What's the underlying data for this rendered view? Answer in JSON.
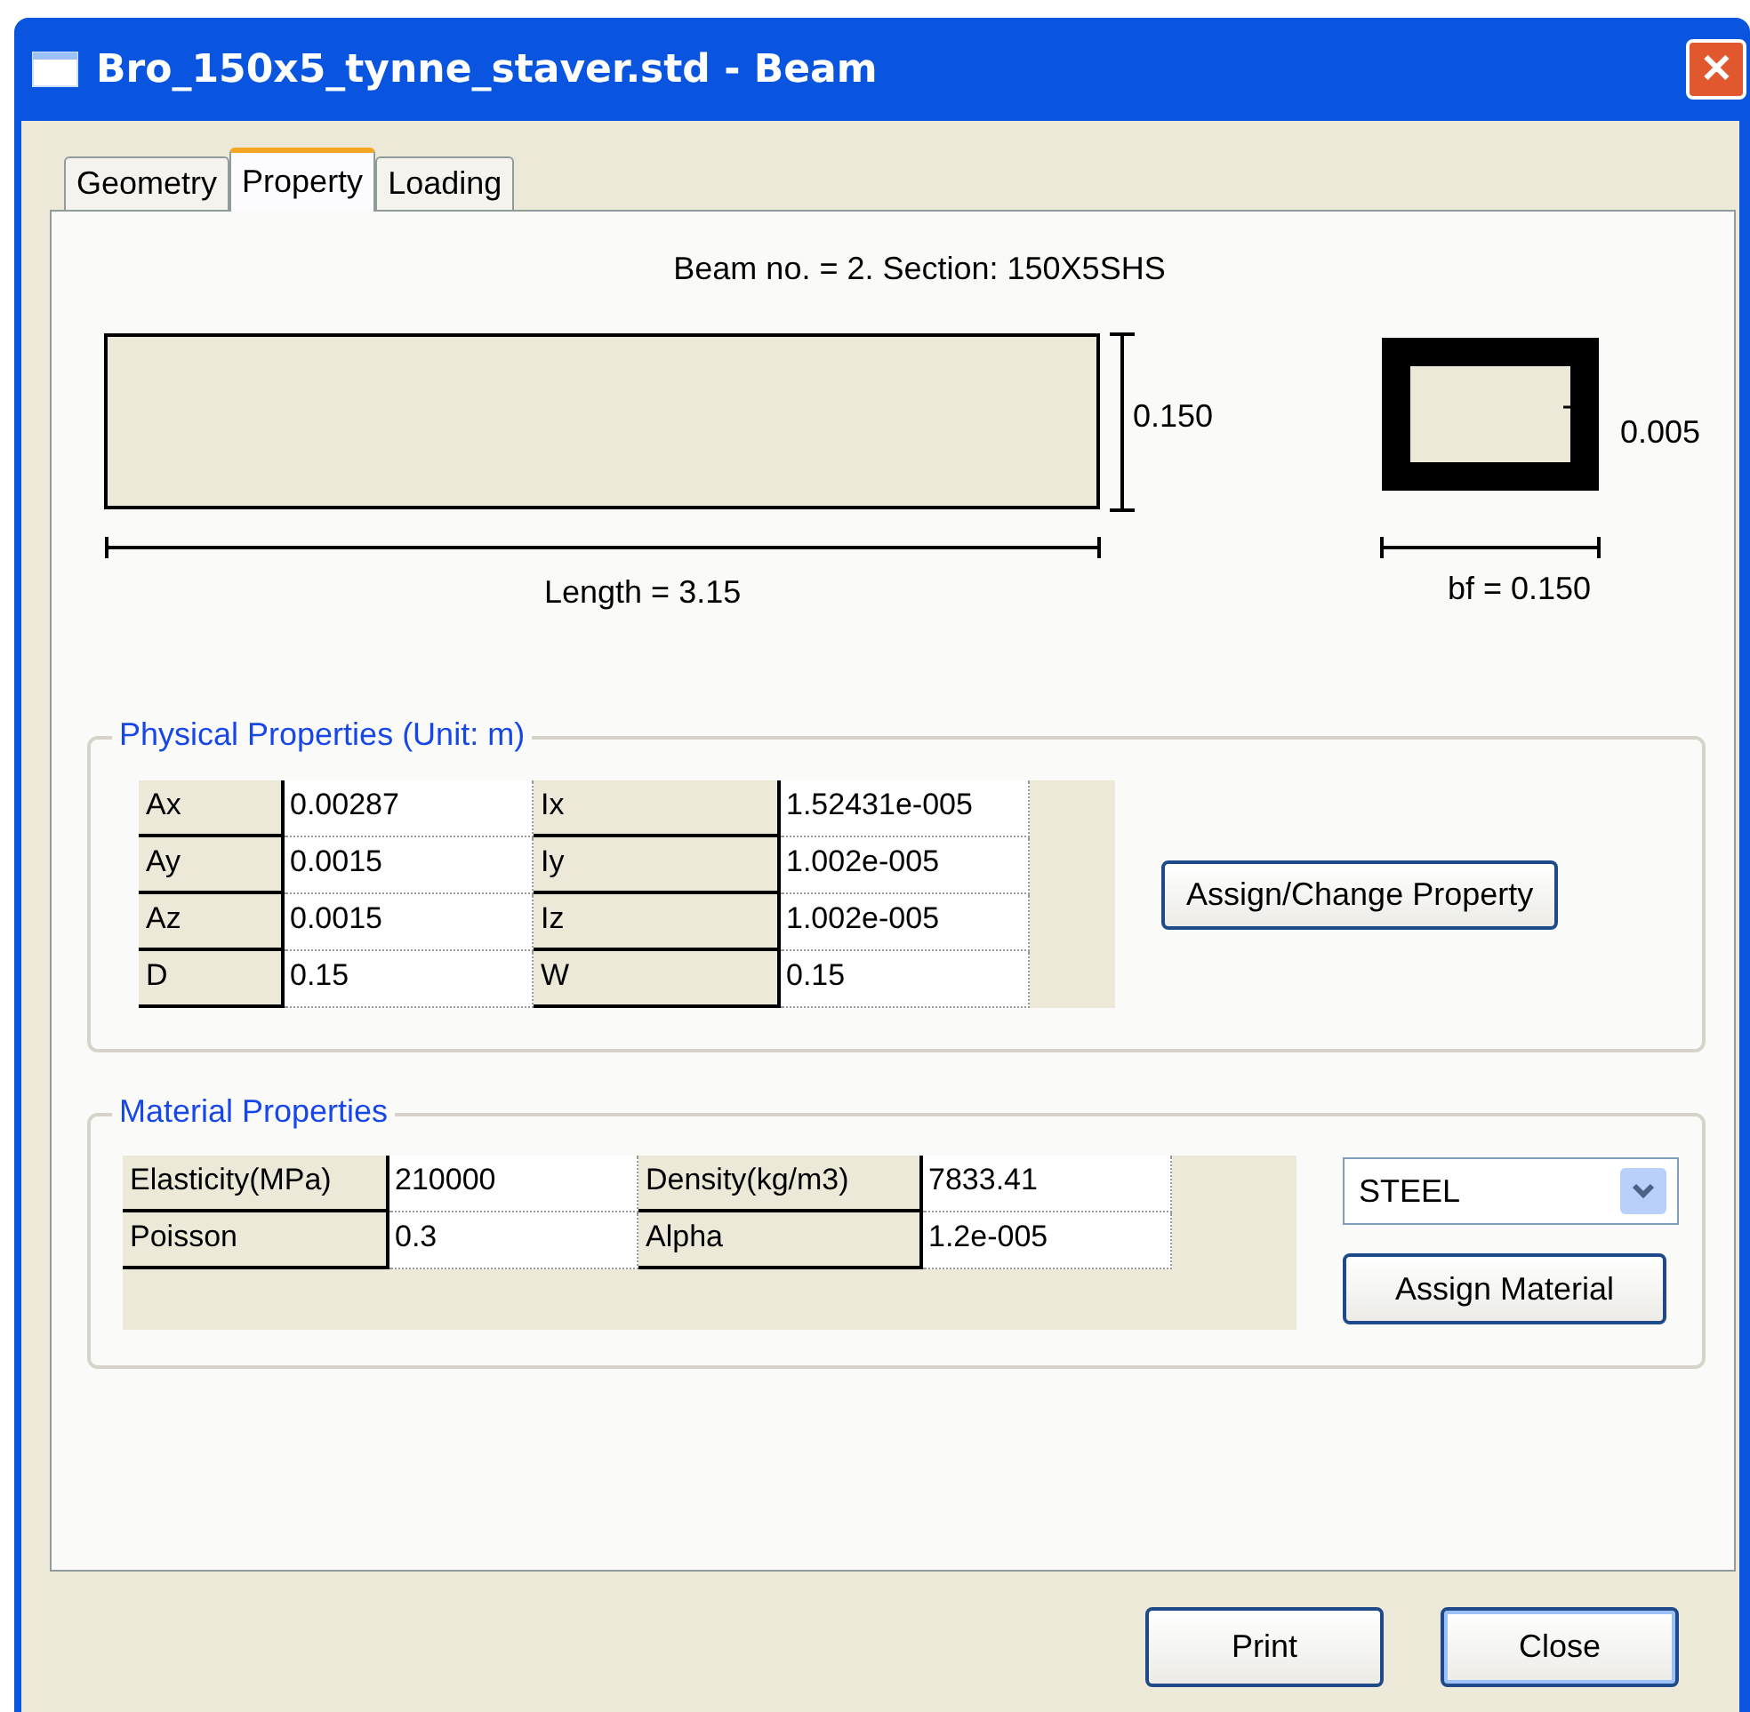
{
  "window": {
    "title": "Bro_150x5_tynne_staver.std - Beam",
    "close": "✕"
  },
  "tabs": [
    {
      "label": "Geometry",
      "selected": false
    },
    {
      "label": "Property",
      "selected": true
    },
    {
      "label": "Loading",
      "selected": false
    }
  ],
  "heading": "Beam no. = 2. Section: 150X5SHS",
  "drawing": {
    "depth_label": "0.150",
    "length_label": "Length = 3.15",
    "thickness_label": "0.005",
    "width_label": "bf = 0.150"
  },
  "physical": {
    "legend": "Physical Properties (Unit: m)",
    "rows": [
      [
        {
          "label": "Ax",
          "value": "0.00287"
        },
        {
          "label": "Ix",
          "value": "1.52431e-005"
        }
      ],
      [
        {
          "label": "Ay",
          "value": "0.0015"
        },
        {
          "label": "Iy",
          "value": "1.002e-005"
        }
      ],
      [
        {
          "label": "Az",
          "value": "0.0015"
        },
        {
          "label": "Iz",
          "value": "1.002e-005"
        }
      ],
      [
        {
          "label": "D",
          "value": "0.15"
        },
        {
          "label": "W",
          "value": "0.15"
        }
      ]
    ],
    "button": "Assign/Change Property"
  },
  "material": {
    "legend": "Material Properties",
    "rows": [
      [
        {
          "label": "Elasticity(MPa)",
          "value": "210000"
        },
        {
          "label": "Density(kg/m3)",
          "value": "7833.41"
        }
      ],
      [
        {
          "label": "Poisson",
          "value": "0.3"
        },
        {
          "label": "Alpha",
          "value": "1.2e-005"
        }
      ]
    ],
    "dropdown": "STEEL",
    "button": "Assign Material"
  },
  "buttons": [
    "Print",
    "Close"
  ]
}
